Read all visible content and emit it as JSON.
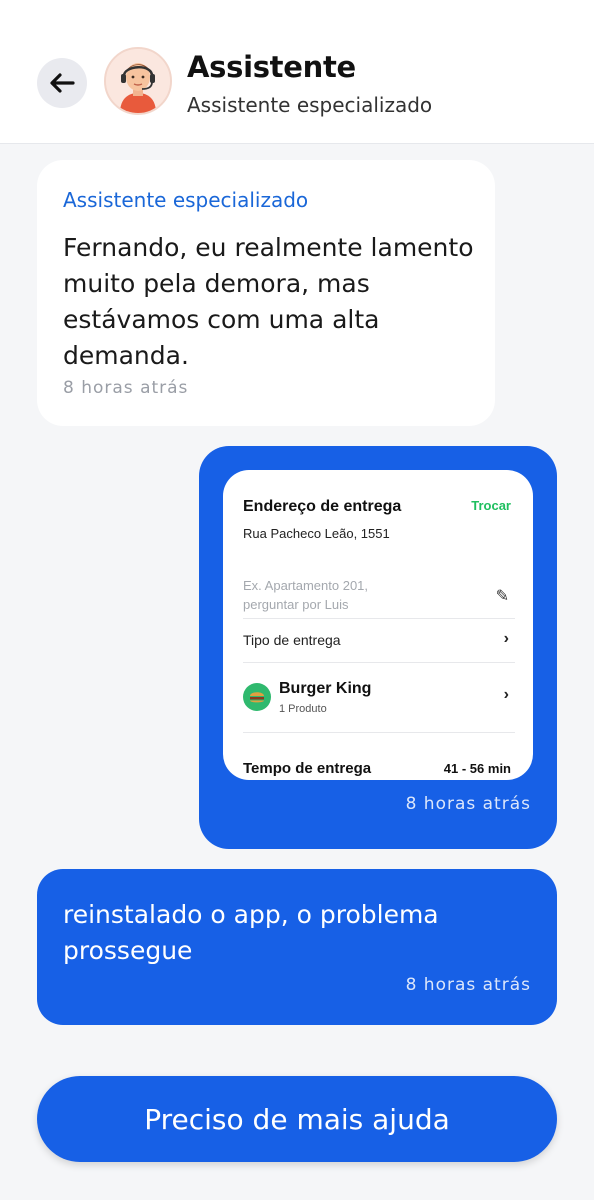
{
  "header": {
    "title": "Assistente",
    "subtitle": "Assistente especializado",
    "back_icon": "arrow-left-icon",
    "avatar_icon": "support-agent-avatar"
  },
  "messages": {
    "incoming": {
      "sender": "Assistente especializado",
      "text": "Fernando, eu realmente lamento muito pela demora, mas estávamos com uma alta demanda.",
      "time": "8 horas atrás"
    },
    "image_message": {
      "time": "8 horas atrás",
      "screenshot": {
        "address_title": "Endereço de entrega",
        "change_label": "Trocar",
        "address": "Rua Pacheco Leão, 1551",
        "complement_placeholder": "Ex. Apartamento 201, perguntar por Luis",
        "delivery_type": "Tipo de entrega",
        "store_name": "Burger King",
        "store_items": "1 Produto",
        "delivery_time_label": "Tempo de entrega",
        "delivery_time_value": "41 - 56 min"
      }
    },
    "outgoing": {
      "text": "reinstalado o app, o problema prossegue",
      "time": "8 horas atrás"
    }
  },
  "help_button": {
    "label": "Preciso de mais ajuda"
  },
  "colors": {
    "primary": "#1760e6",
    "link": "#1a67d8",
    "success": "#1fbf5f",
    "background": "#f5f6f8"
  }
}
